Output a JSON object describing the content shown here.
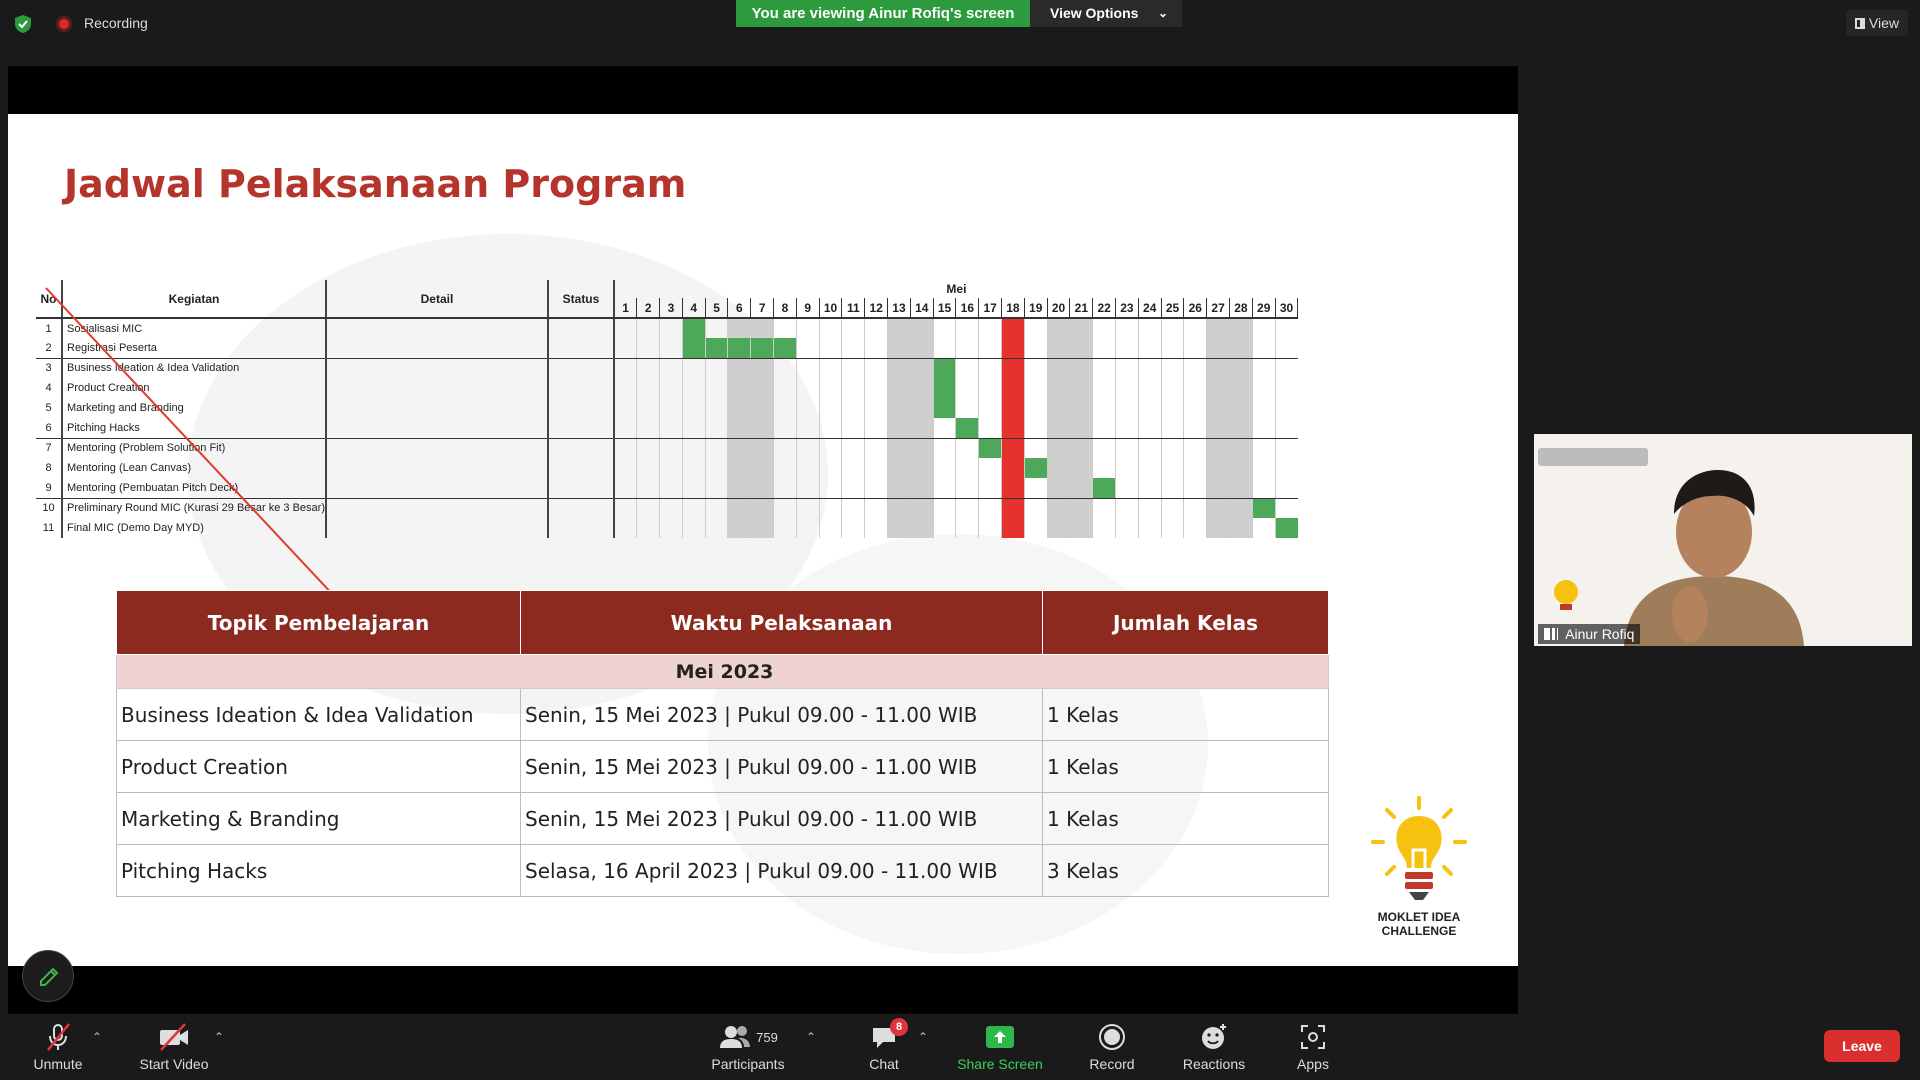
{
  "topbar": {
    "recording_label": "Recording",
    "viewing_label": "You are viewing Ainur Rofiq's screen",
    "view_options_label": "View Options",
    "view_label": "View"
  },
  "slide": {
    "title": "Jadwal Pelaksanaan Program",
    "gantt": {
      "headers": {
        "no": "No",
        "kegiatan": "Kegiatan",
        "detail": "Detail",
        "status": "Status",
        "month": "Mei"
      },
      "days": [
        "1",
        "2",
        "3",
        "4",
        "5",
        "6",
        "7",
        "8",
        "9",
        "10",
        "11",
        "12",
        "13",
        "14",
        "15",
        "16",
        "17",
        "18",
        "19",
        "20",
        "21",
        "22",
        "23",
        "24",
        "25",
        "26",
        "27",
        "28",
        "29",
        "30"
      ],
      "weekend_days": [
        6,
        7,
        13,
        14,
        20,
        21,
        27,
        28
      ],
      "highlight_day": 18,
      "rows": [
        {
          "no": "1",
          "kegiatan": "Sosialisasi MIC",
          "bars": [
            4
          ]
        },
        {
          "no": "2",
          "kegiatan": "Registrasi Peserta",
          "bars": [
            4,
            5,
            6,
            7,
            8
          ]
        },
        {
          "no": "3",
          "kegiatan": "Business Ideation & Idea Validation",
          "bars": [
            15
          ]
        },
        {
          "no": "4",
          "kegiatan": "Product Creation",
          "bars": [
            15
          ]
        },
        {
          "no": "5",
          "kegiatan": "Marketing and Branding",
          "bars": [
            15
          ]
        },
        {
          "no": "6",
          "kegiatan": "Pitching Hacks",
          "bars": [
            16
          ]
        },
        {
          "no": "7",
          "kegiatan": "Mentoring (Problem Solution Fit)",
          "bars": [
            17
          ]
        },
        {
          "no": "8",
          "kegiatan": "Mentoring (Lean Canvas)",
          "bars": [
            19
          ]
        },
        {
          "no": "9",
          "kegiatan": "Mentoring (Pembuatan Pitch Deck)",
          "bars": [
            22
          ]
        },
        {
          "no": "10",
          "kegiatan": "Preliminary Round MIC (Kurasi 29 Besar ke 3 Besar)",
          "bars": [
            29
          ]
        },
        {
          "no": "11",
          "kegiatan": "Final MIC (Demo Day MYD)",
          "bars": [
            30
          ]
        }
      ]
    },
    "schedule": {
      "headers": [
        "Topik Pembelajaran",
        "Waktu Pelaksanaan",
        "Jumlah Kelas"
      ],
      "month": "Mei 2023",
      "rows": [
        [
          "Business Ideation & Idea Validation",
          "Senin, 15 Mei 2023 | Pukul 09.00 - 11.00 WIB",
          "1 Kelas"
        ],
        [
          "Product Creation",
          "Senin, 15 Mei 2023 | Pukul 09.00 - 11.00 WIB",
          "1 Kelas"
        ],
        [
          "Marketing & Branding",
          "Senin, 15 Mei 2023 | Pukul 09.00 - 11.00 WIB",
          "1 Kelas"
        ],
        [
          "Pitching Hacks",
          "Selasa, 16 April 2023 | Pukul 09.00 - 11.00 WIB",
          "3 Kelas"
        ]
      ]
    },
    "logo_line1": "MOKLET IDEA",
    "logo_line2": "CHALLENGE"
  },
  "video": {
    "name": "Ainur Rofiq"
  },
  "toolbar": {
    "unmute": "Unmute",
    "start_video": "Start Video",
    "participants_count": "759",
    "participants": "Participants",
    "chat_badge": "8",
    "chat": "Chat",
    "share_screen": "Share Screen",
    "record": "Record",
    "reactions": "Reactions",
    "apps": "Apps",
    "leave": "Leave"
  },
  "colors": {
    "accent_green": "#2d9a3e",
    "title_red": "#b5342c",
    "table_header": "#8c2a1f",
    "gantt_bar": "#4da859",
    "gantt_highlight": "#e5322c",
    "leave_red": "#d9302f"
  }
}
